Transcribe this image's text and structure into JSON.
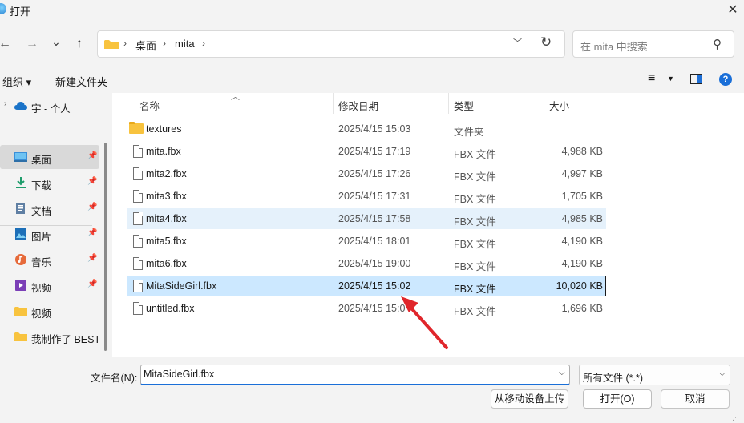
{
  "window": {
    "title": "打开",
    "close_glyph": "✕"
  },
  "nav": {
    "back_glyph": "←",
    "forward_glyph": "→",
    "recent_glyph": "⌄",
    "up_glyph": "↑",
    "breadcrumbs": [
      "桌面",
      "mita"
    ],
    "sep_glyph": "›",
    "refresh_glyph": "↻",
    "dropdown_glyph": "﹀"
  },
  "search": {
    "placeholder": "在 mita 中搜索",
    "icon_glyph": "⚲"
  },
  "toolbar": {
    "organize": "组织 ▾",
    "new_folder": "新建文件夹",
    "view_glyph": "≡",
    "view_drop": "▼",
    "help": "?"
  },
  "sidebar": {
    "top_item": {
      "label": "宇 - 个人"
    },
    "items": [
      {
        "label": "桌面",
        "pinned": true
      },
      {
        "label": "下载",
        "pinned": true
      },
      {
        "label": "文档",
        "pinned": true
      },
      {
        "label": "图片",
        "pinned": true
      },
      {
        "label": "音乐",
        "pinned": true
      },
      {
        "label": "视频",
        "pinned": true
      },
      {
        "label": "视频",
        "pinned": false
      },
      {
        "label": "我制作了 BEST",
        "pinned": false
      }
    ],
    "pin_glyph": "📌"
  },
  "columns": {
    "name": "名称",
    "date": "修改日期",
    "type": "类型",
    "size": "大小"
  },
  "files": [
    {
      "name": "textures",
      "date": "2025/4/15 15:03",
      "type": "文件夹",
      "size": ""
    },
    {
      "name": "mita.fbx",
      "date": "2025/4/15 17:19",
      "type": "FBX 文件",
      "size": "4,988 KB"
    },
    {
      "name": "mita2.fbx",
      "date": "2025/4/15 17:26",
      "type": "FBX 文件",
      "size": "4,997 KB"
    },
    {
      "name": "mita3.fbx",
      "date": "2025/4/15 17:31",
      "type": "FBX 文件",
      "size": "1,705 KB"
    },
    {
      "name": "mita4.fbx",
      "date": "2025/4/15 17:58",
      "type": "FBX 文件",
      "size": "4,985 KB"
    },
    {
      "name": "mita5.fbx",
      "date": "2025/4/15 18:01",
      "type": "FBX 文件",
      "size": "4,190 KB"
    },
    {
      "name": "mita6.fbx",
      "date": "2025/4/15 19:00",
      "type": "FBX 文件",
      "size": "4,190 KB"
    },
    {
      "name": "MitaSideGirl.fbx",
      "date": "2025/4/15 15:02",
      "type": "FBX 文件",
      "size": "10,020 KB"
    },
    {
      "name": "untitled.fbx",
      "date": "2025/4/15 15:0",
      "type": "FBX 文件",
      "size": "1,696 KB"
    }
  ],
  "bottom": {
    "filename_label": "文件名(N):",
    "filename_value": "MitaSideGirl.fbx",
    "filetype_value": "所有文件 (*.*)",
    "btn_mobile": "从移动设备上传",
    "btn_open": "打开(O)",
    "btn_cancel": "取消",
    "drop_glyph": "⌵",
    "grip_glyph": "⋰"
  },
  "colors": {
    "accent": "#1a6fd8",
    "selection": "#cce8ff",
    "hover": "#e5f1fb",
    "arrow": "#e0262b"
  }
}
